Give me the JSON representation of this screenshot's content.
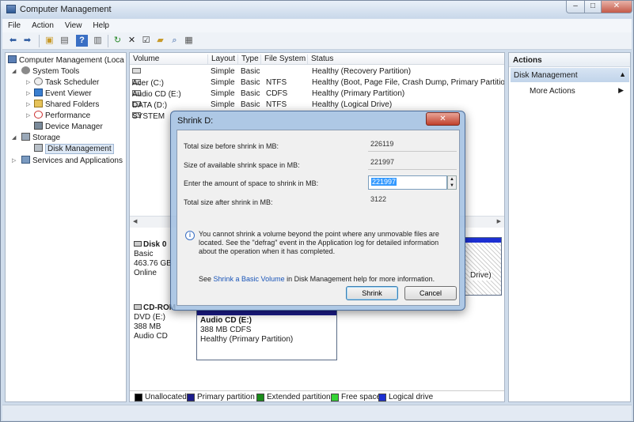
{
  "window": {
    "title": "Computer Management",
    "minimize": "–",
    "maximize": "□",
    "close": "✕"
  },
  "menu": [
    "File",
    "Action",
    "View",
    "Help"
  ],
  "tree": {
    "root": "Computer Management (Loca",
    "system_tools": "System Tools",
    "task_scheduler": "Task Scheduler",
    "event_viewer": "Event Viewer",
    "shared_folders": "Shared Folders",
    "performance": "Performance",
    "device_manager": "Device Manager",
    "storage": "Storage",
    "disk_management": "Disk Management",
    "services": "Services and Applications"
  },
  "columns": [
    "Volume",
    "Layout",
    "Type",
    "File System",
    "Status"
  ],
  "volumes": [
    {
      "volume": "",
      "layout": "Simple",
      "type": "Basic",
      "fs": "",
      "status": "Healthy (Recovery Partition)"
    },
    {
      "volume": "Acer (C:)",
      "layout": "Simple",
      "type": "Basic",
      "fs": "NTFS",
      "status": "Healthy (Boot, Page File, Crash Dump, Primary Partition)"
    },
    {
      "volume": "Audio CD (E:)",
      "layout": "Simple",
      "type": "Basic",
      "fs": "CDFS",
      "status": "Healthy (Primary Partition)"
    },
    {
      "volume": "DATA (D:)",
      "layout": "Simple",
      "type": "Basic",
      "fs": "NTFS",
      "status": "Healthy (Logical Drive)"
    },
    {
      "volume": "SYSTEM",
      "layout": "",
      "type": "",
      "fs": "",
      "status": ""
    }
  ],
  "disk0": {
    "name": "Disk 0",
    "type": "Basic",
    "size": "463.76 GB",
    "state": "Online",
    "partition_tail": "Drive)"
  },
  "cdrom": {
    "name": "CD-ROM",
    "drive": "DVD (E:)",
    "size": "388 MB",
    "media": "Audio CD",
    "part_name": "Audio CD (E:)",
    "part_size": "388 MB CDFS",
    "part_status": "Healthy (Primary Partition)"
  },
  "legend": [
    {
      "label": "Unallocated",
      "color": "#000000"
    },
    {
      "label": "Primary partition",
      "color": "#1c1c8c"
    },
    {
      "label": "Extended partition",
      "color": "#1a8c1a"
    },
    {
      "label": "Free space",
      "color": "#35d435"
    },
    {
      "label": "Logical drive",
      "color": "#1c2fd2"
    }
  ],
  "actions": {
    "header": "Actions",
    "section": "Disk Management",
    "more": "More Actions"
  },
  "dialog": {
    "title": "Shrink D:",
    "close": "✕",
    "total_size_label": "Total size before shrink in MB:",
    "total_size_value": "226119",
    "available_label": "Size of available shrink space in MB:",
    "available_value": "221997",
    "amount_label": "Enter the amount of space to shrink in MB:",
    "amount_value": "221997",
    "after_label": "Total size after shrink in MB:",
    "after_value": "3122",
    "info": "You cannot shrink a volume beyond the point where any unmovable files are located. See the \"defrag\" event in the Application log for detailed information about the operation when it has completed.",
    "see_prefix": "See",
    "see_link": "Shrink a Basic Volume",
    "see_suffix": "in Disk Management help for more information.",
    "shrink_button": "Shrink",
    "cancel_button": "Cancel"
  }
}
